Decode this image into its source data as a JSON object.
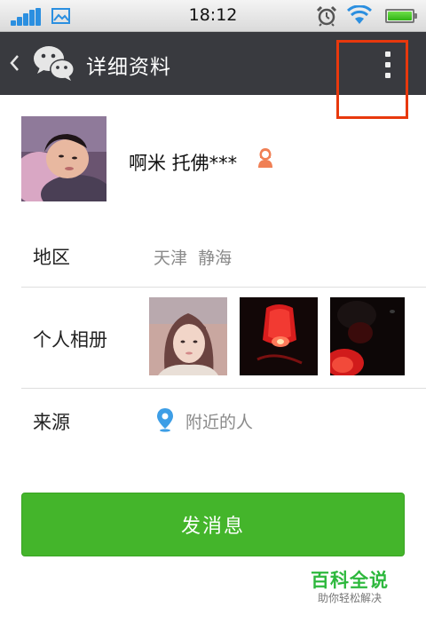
{
  "status_bar": {
    "time": "18:12",
    "icons": [
      "signal-icon",
      "image-icon",
      "alarm-clock-icon",
      "wifi-icon",
      "battery-icon"
    ]
  },
  "title_bar": {
    "back_icon": "chevron-left-icon",
    "logo_icon": "wechat-logo-icon",
    "title": "详细资料",
    "more_icon": "more-vertical-icon",
    "highlight_color": "#e8380d",
    "background_color": "#393a3f"
  },
  "profile": {
    "nickname": "啊米 托佛***",
    "gender_icon": "female-user-icon"
  },
  "region": {
    "label": "地区",
    "value": "天津  静海"
  },
  "album": {
    "label": "个人相册",
    "photos": [
      "portrait-photo",
      "red-sky-lantern-photo",
      "night-lantern-photo"
    ]
  },
  "source": {
    "label": "来源",
    "icon": "location-pin-icon",
    "value": "附近的人"
  },
  "actions": {
    "send_message": "发消息",
    "button_color": "#44b52b"
  },
  "watermark": {
    "title": "百科全说",
    "subtitle": "助你轻松解决"
  }
}
